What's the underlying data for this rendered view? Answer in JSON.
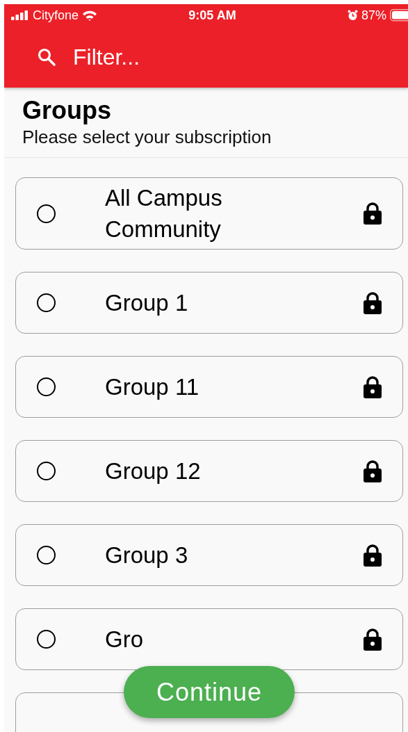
{
  "status_bar": {
    "carrier": "Cityfone",
    "time": "9:05 AM",
    "battery": "87%"
  },
  "search": {
    "placeholder": "Filter..."
  },
  "header": {
    "title": "Groups",
    "subtitle": "Please select your subscription"
  },
  "groups": [
    {
      "label": "All Campus Community",
      "selected": false,
      "locked": true
    },
    {
      "label": "Group 1",
      "selected": false,
      "locked": true
    },
    {
      "label": "Group 11",
      "selected": false,
      "locked": true
    },
    {
      "label": "Group 12",
      "selected": false,
      "locked": true
    },
    {
      "label": "Group 3",
      "selected": false,
      "locked": true
    },
    {
      "label": "Gro",
      "selected": false,
      "locked": true
    }
  ],
  "continue_button": "Continue"
}
